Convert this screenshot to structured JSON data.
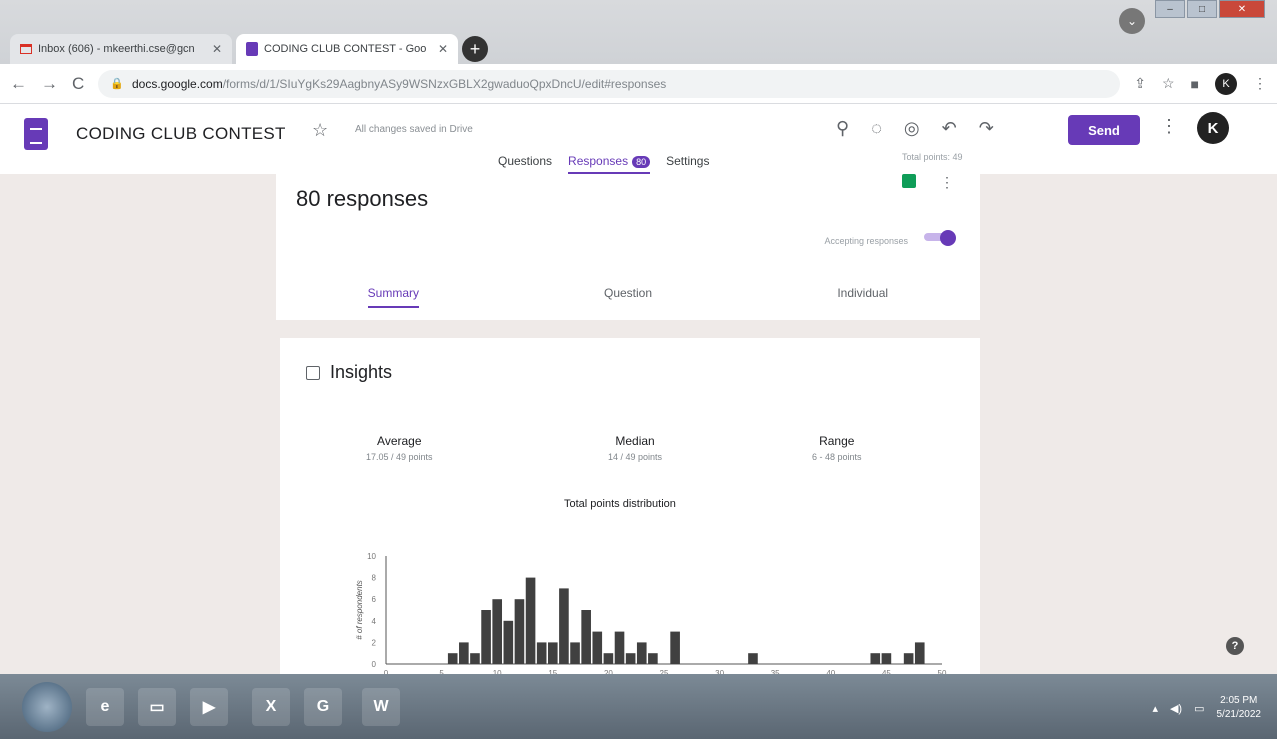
{
  "browser": {
    "tabs": [
      {
        "title": "Inbox (606) - mkeerthi.cse@gcn",
        "active": false
      },
      {
        "title": "CODING CLUB CONTEST - Goo",
        "active": true
      }
    ],
    "new_tab": "+",
    "address": {
      "host": "docs.google.com",
      "path": "/forms/d/1/SIuYgKs29AagbnyASy9WSNzxGBLX2gwaduoQpxDncU/edit#responses"
    },
    "profile_initial": "K"
  },
  "form": {
    "title": "CODING CLUB CONTEST",
    "saved_status": "All changes saved in Drive",
    "send_label": "Send",
    "avatar_initial": "K",
    "tabs": {
      "questions": "Questions",
      "responses": "Responses",
      "responses_badge": "80",
      "settings": "Settings"
    },
    "total_points": "Total points: 49"
  },
  "responses": {
    "count_label": "80 responses",
    "accepting_label": "Accepting responses",
    "subtabs": {
      "summary": "Summary",
      "question": "Question",
      "individual": "Individual"
    }
  },
  "insights": {
    "title": "Insights",
    "average_label": "Average",
    "average_value": "17.05 / 49 points",
    "median_label": "Median",
    "median_value": "14 / 49 points",
    "range_label": "Range",
    "range_value": "6 - 48 points"
  },
  "chart_data": {
    "type": "bar",
    "title": "Total points distribution",
    "ylabel": "# of respondents",
    "xlabel": "",
    "xlim": [
      0,
      50
    ],
    "ylim": [
      0,
      10
    ],
    "x_ticks": [
      0,
      5,
      10,
      15,
      20,
      25,
      30,
      35,
      40,
      45,
      50
    ],
    "y_ticks": [
      0,
      2,
      4,
      6,
      8,
      10
    ],
    "x": [
      6,
      7,
      8,
      9,
      10,
      11,
      12,
      13,
      14,
      15,
      16,
      17,
      18,
      19,
      20,
      21,
      22,
      23,
      24,
      26,
      33,
      44,
      45,
      47,
      48
    ],
    "values": [
      1,
      2,
      1,
      5,
      6,
      4,
      6,
      8,
      2,
      2,
      7,
      2,
      5,
      3,
      1,
      3,
      1,
      2,
      1,
      3,
      1,
      1,
      1,
      1,
      2
    ]
  },
  "taskbar": {
    "time": "2:05 PM",
    "date": "5/21/2022"
  },
  "colors": {
    "accent": "#673ab7",
    "bar": "#404040"
  }
}
